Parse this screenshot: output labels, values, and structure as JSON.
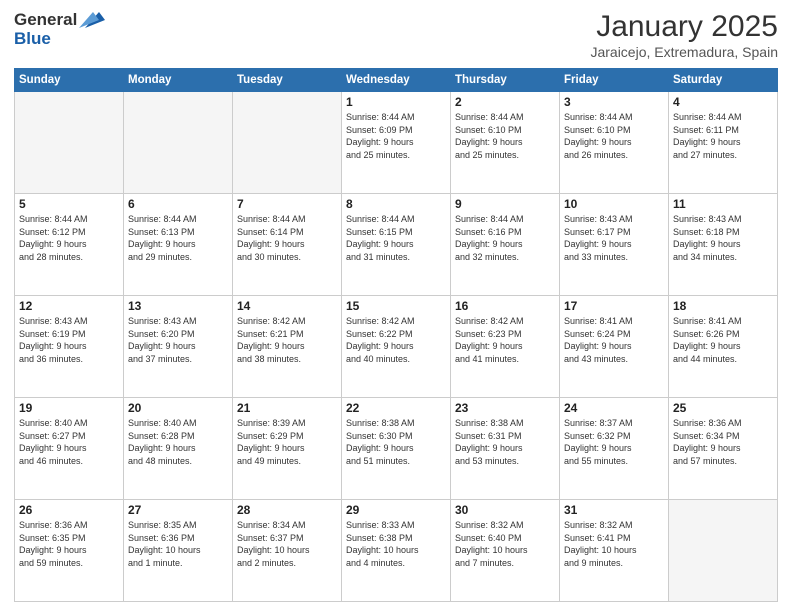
{
  "logo": {
    "general": "General",
    "blue": "Blue"
  },
  "title": "January 2025",
  "subtitle": "Jaraicejo, Extremadura, Spain",
  "days_header": [
    "Sunday",
    "Monday",
    "Tuesday",
    "Wednesday",
    "Thursday",
    "Friday",
    "Saturday"
  ],
  "weeks": [
    [
      {
        "day": "",
        "info": ""
      },
      {
        "day": "",
        "info": ""
      },
      {
        "day": "",
        "info": ""
      },
      {
        "day": "1",
        "info": "Sunrise: 8:44 AM\nSunset: 6:09 PM\nDaylight: 9 hours\nand 25 minutes."
      },
      {
        "day": "2",
        "info": "Sunrise: 8:44 AM\nSunset: 6:10 PM\nDaylight: 9 hours\nand 25 minutes."
      },
      {
        "day": "3",
        "info": "Sunrise: 8:44 AM\nSunset: 6:10 PM\nDaylight: 9 hours\nand 26 minutes."
      },
      {
        "day": "4",
        "info": "Sunrise: 8:44 AM\nSunset: 6:11 PM\nDaylight: 9 hours\nand 27 minutes."
      }
    ],
    [
      {
        "day": "5",
        "info": "Sunrise: 8:44 AM\nSunset: 6:12 PM\nDaylight: 9 hours\nand 28 minutes."
      },
      {
        "day": "6",
        "info": "Sunrise: 8:44 AM\nSunset: 6:13 PM\nDaylight: 9 hours\nand 29 minutes."
      },
      {
        "day": "7",
        "info": "Sunrise: 8:44 AM\nSunset: 6:14 PM\nDaylight: 9 hours\nand 30 minutes."
      },
      {
        "day": "8",
        "info": "Sunrise: 8:44 AM\nSunset: 6:15 PM\nDaylight: 9 hours\nand 31 minutes."
      },
      {
        "day": "9",
        "info": "Sunrise: 8:44 AM\nSunset: 6:16 PM\nDaylight: 9 hours\nand 32 minutes."
      },
      {
        "day": "10",
        "info": "Sunrise: 8:43 AM\nSunset: 6:17 PM\nDaylight: 9 hours\nand 33 minutes."
      },
      {
        "day": "11",
        "info": "Sunrise: 8:43 AM\nSunset: 6:18 PM\nDaylight: 9 hours\nand 34 minutes."
      }
    ],
    [
      {
        "day": "12",
        "info": "Sunrise: 8:43 AM\nSunset: 6:19 PM\nDaylight: 9 hours\nand 36 minutes."
      },
      {
        "day": "13",
        "info": "Sunrise: 8:43 AM\nSunset: 6:20 PM\nDaylight: 9 hours\nand 37 minutes."
      },
      {
        "day": "14",
        "info": "Sunrise: 8:42 AM\nSunset: 6:21 PM\nDaylight: 9 hours\nand 38 minutes."
      },
      {
        "day": "15",
        "info": "Sunrise: 8:42 AM\nSunset: 6:22 PM\nDaylight: 9 hours\nand 40 minutes."
      },
      {
        "day": "16",
        "info": "Sunrise: 8:42 AM\nSunset: 6:23 PM\nDaylight: 9 hours\nand 41 minutes."
      },
      {
        "day": "17",
        "info": "Sunrise: 8:41 AM\nSunset: 6:24 PM\nDaylight: 9 hours\nand 43 minutes."
      },
      {
        "day": "18",
        "info": "Sunrise: 8:41 AM\nSunset: 6:26 PM\nDaylight: 9 hours\nand 44 minutes."
      }
    ],
    [
      {
        "day": "19",
        "info": "Sunrise: 8:40 AM\nSunset: 6:27 PM\nDaylight: 9 hours\nand 46 minutes."
      },
      {
        "day": "20",
        "info": "Sunrise: 8:40 AM\nSunset: 6:28 PM\nDaylight: 9 hours\nand 48 minutes."
      },
      {
        "day": "21",
        "info": "Sunrise: 8:39 AM\nSunset: 6:29 PM\nDaylight: 9 hours\nand 49 minutes."
      },
      {
        "day": "22",
        "info": "Sunrise: 8:38 AM\nSunset: 6:30 PM\nDaylight: 9 hours\nand 51 minutes."
      },
      {
        "day": "23",
        "info": "Sunrise: 8:38 AM\nSunset: 6:31 PM\nDaylight: 9 hours\nand 53 minutes."
      },
      {
        "day": "24",
        "info": "Sunrise: 8:37 AM\nSunset: 6:32 PM\nDaylight: 9 hours\nand 55 minutes."
      },
      {
        "day": "25",
        "info": "Sunrise: 8:36 AM\nSunset: 6:34 PM\nDaylight: 9 hours\nand 57 minutes."
      }
    ],
    [
      {
        "day": "26",
        "info": "Sunrise: 8:36 AM\nSunset: 6:35 PM\nDaylight: 9 hours\nand 59 minutes."
      },
      {
        "day": "27",
        "info": "Sunrise: 8:35 AM\nSunset: 6:36 PM\nDaylight: 10 hours\nand 1 minute."
      },
      {
        "day": "28",
        "info": "Sunrise: 8:34 AM\nSunset: 6:37 PM\nDaylight: 10 hours\nand 2 minutes."
      },
      {
        "day": "29",
        "info": "Sunrise: 8:33 AM\nSunset: 6:38 PM\nDaylight: 10 hours\nand 4 minutes."
      },
      {
        "day": "30",
        "info": "Sunrise: 8:32 AM\nSunset: 6:40 PM\nDaylight: 10 hours\nand 7 minutes."
      },
      {
        "day": "31",
        "info": "Sunrise: 8:32 AM\nSunset: 6:41 PM\nDaylight: 10 hours\nand 9 minutes."
      },
      {
        "day": "",
        "info": ""
      }
    ]
  ]
}
